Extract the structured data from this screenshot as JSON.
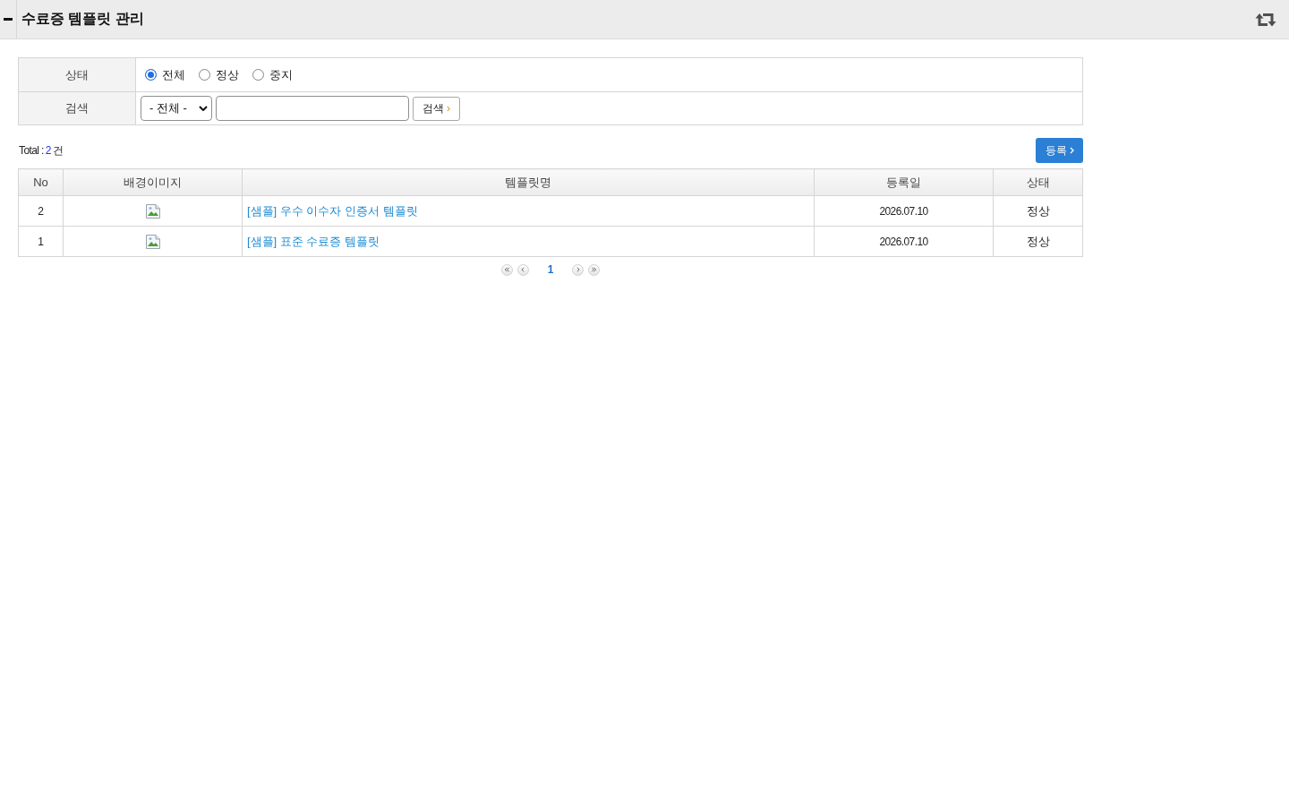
{
  "header": {
    "title": "수료증 템플릿 관리"
  },
  "filters": {
    "status": {
      "label": "상태",
      "options": [
        {
          "label": "전체",
          "selected": true
        },
        {
          "label": "정상",
          "selected": false
        },
        {
          "label": "중지",
          "selected": false
        }
      ]
    },
    "search": {
      "label": "검색",
      "field_select": "- 전체 -",
      "button": "검색"
    }
  },
  "summary": {
    "label": "Total :",
    "count": "2",
    "unit": "건"
  },
  "register_button": "등록",
  "table": {
    "columns": [
      "No",
      "배경이미지",
      "템플릿명",
      "등록일",
      "상태"
    ],
    "rows": [
      {
        "no": "2",
        "name": "[샘플] 우수 이수자 인증서 템플릿",
        "date": "2026.07.10",
        "status": "정상"
      },
      {
        "no": "1",
        "name": "[샘플] 표준 수료증 템플릿",
        "date": "2026.07.10",
        "status": "정상"
      }
    ]
  },
  "pagination": {
    "pages": [
      {
        "label": "1",
        "selected": true
      }
    ]
  }
}
